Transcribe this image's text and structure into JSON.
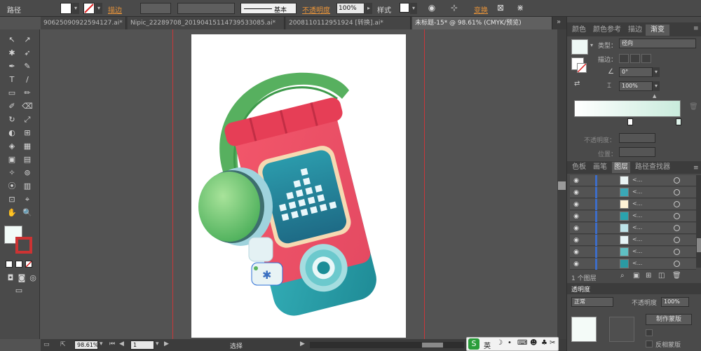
{
  "control_bar": {
    "path_label": "路径",
    "stroke_label": "描边",
    "stroke_style_label": "基本",
    "opacity_label": "不透明度",
    "opacity_value": "100%",
    "style_label": "样式",
    "transform_label": "变换"
  },
  "tabs": [
    {
      "label": "9062509092259412​7.ai*"
    },
    {
      "label": "Nipic_22289708_20190415114739533085.ai*"
    },
    {
      "label": "20081101129​51924 [转换].ai*"
    },
    {
      "label": "未标题-15* @ 98.61% (CMYK/预览)"
    }
  ],
  "tools": [
    "↖",
    "↗",
    "✱",
    "➶",
    "✒",
    "✎",
    "T",
    "/",
    "▭",
    "✏",
    "✐",
    "⌫",
    "↻",
    "⤢",
    "◐",
    "⊞",
    "◈",
    "▦",
    "▣",
    "▤",
    "✧",
    "⊚",
    "⦿",
    "▥",
    "⊡",
    "⌖",
    "✋",
    "🔍"
  ],
  "gradient_panel": {
    "tabs": [
      "颜色",
      "颜色参考",
      "描边",
      "渐变"
    ],
    "type_label": "类型：",
    "type_value": "径向",
    "stroke_label": "描边：",
    "angle_value": "0°",
    "ratio_value": "100%",
    "opacity_label": "不透明度：",
    "location_label": "位置："
  },
  "layers_panel": {
    "tabs": [
      "色板",
      "画笔",
      "图层",
      "路径查找器"
    ],
    "rows": [
      {
        "name": "<...",
        "thumb_color": "#e9f3f3"
      },
      {
        "name": "<...",
        "thumb_color": "#3aa8b6"
      },
      {
        "name": "<...",
        "thumb_color": "#fff3d6"
      },
      {
        "name": "<...",
        "thumb_color": "#2aa3ad"
      },
      {
        "name": "<...",
        "thumb_color": "#bde3e8"
      },
      {
        "name": "<...",
        "thumb_color": "#e6f4f6"
      },
      {
        "name": "<...",
        "thumb_color": "#5fc0c3"
      },
      {
        "name": "<...",
        "thumb_color": "#2a9aa3"
      }
    ],
    "layer_count": "1 个图层"
  },
  "transparency_panel": {
    "title": "透明度",
    "mode": "正常",
    "opacity_value": "100%",
    "make_mask_label": "制作蒙版",
    "invert_mask_label": "反相蒙版"
  },
  "status_bar": {
    "zoom": "98.61%",
    "artboard_index": "1",
    "tool_hint": "选择"
  },
  "ime": {
    "lang": "英"
  },
  "colors": {
    "accent": "#e8943a",
    "guide": "#c9373a"
  }
}
